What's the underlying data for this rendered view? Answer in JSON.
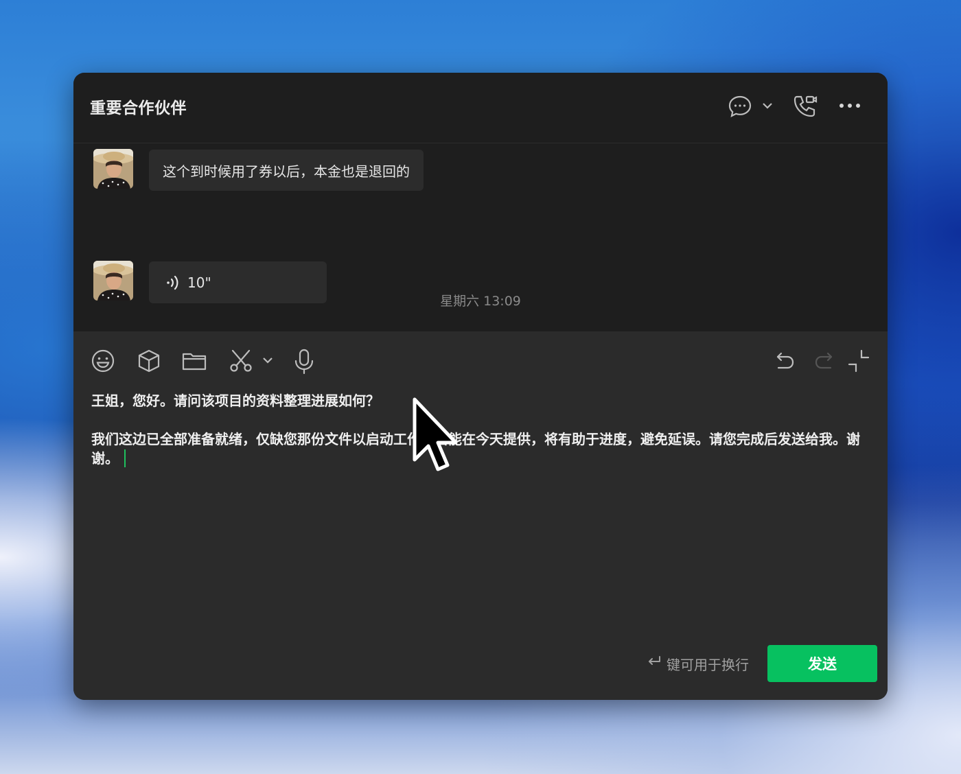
{
  "window": {
    "title": "重要合作伙伴"
  },
  "header_icons": {
    "chat": "chat-bubble-icon",
    "dropdown": "chevron-down-icon",
    "call": "phone-video-icon",
    "more": "more-dots-icon"
  },
  "messages": [
    {
      "type": "text",
      "sender_avatar": "avatar-woman-hat",
      "text": "这个到时候用了券以后，本金也是退回的"
    },
    {
      "type": "timestamp",
      "text": "星期六 13:09"
    },
    {
      "type": "voice",
      "sender_avatar": "avatar-woman-hat",
      "duration": "10\""
    }
  ],
  "toolbar": {
    "left": [
      "emoji-icon",
      "sticker-cube-icon",
      "folder-icon",
      "scissors-icon",
      "chevron-down-icon",
      "microphone-icon"
    ],
    "right": [
      "undo-icon",
      "redo-icon",
      "collapse-icon"
    ]
  },
  "composer": {
    "line1": "王姐，您好。请问该项目的资料整理进展如何？",
    "line2": "我们这边已全部准备就绪，仅缺您那份文件以启动工作。若能在今天提供，将有助于进度，避免延误。请您完成后发送给我。谢谢。",
    "hint": "键可用于换行",
    "send_label": "发送"
  },
  "colors": {
    "accent": "#07c160",
    "header_bg": "#1e1e1e",
    "composer_bg": "#2b2b2b",
    "bubble_bg": "#2c2c2c"
  }
}
